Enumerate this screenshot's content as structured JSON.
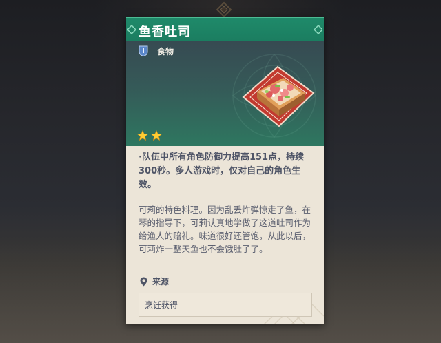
{
  "item": {
    "title": "鱼香吐司",
    "type_label": "食物",
    "type_icon": "food-shield-icon",
    "rarity_stars": 2,
    "effect": "·队伍中所有角色防御力提高151点，持续300秒。多人游戏时，仅对自己的角色生效。",
    "description": "可莉的特色料理。因为乱丢炸弹惊走了鱼，在琴的指导下，可莉认真地学做了这道吐司作为给渔人的赔礼。味道很好还管饱，从此以后，可莉炸一整天鱼也不会饿肚子了。",
    "source_label": "来源",
    "source_icon": "location-pin-icon",
    "sources": [
      "烹饪获得"
    ]
  },
  "colors": {
    "header_green": "#1f8a6a",
    "star_gold": "#ffcc33",
    "card_bg": "#ece5d8",
    "text_dark": "#4f5567"
  }
}
